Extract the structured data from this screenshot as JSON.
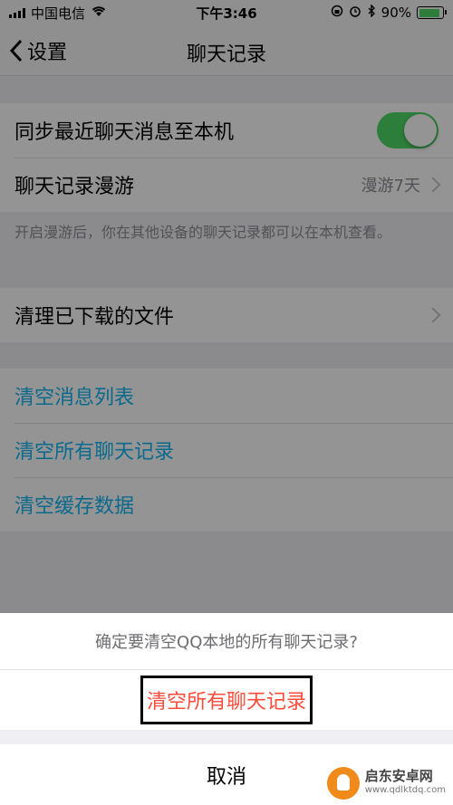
{
  "status_bar": {
    "carrier": "中国电信",
    "time": "下午3:46",
    "battery": "90%",
    "battery_level": 0.9
  },
  "nav": {
    "back_label": "设置",
    "title": "聊天记录"
  },
  "settings": {
    "sync_label": "同步最近聊天消息至本机",
    "sync_on": true,
    "roam_label": "聊天记录漫游",
    "roam_value": "漫游7天",
    "roam_note": "开启漫游后，你在其他设备的聊天记录都可以在本机查看。",
    "clean_downloads_label": "清理已下载的文件",
    "clear_message_list": "清空消息列表",
    "clear_all_history": "清空所有聊天记录",
    "clear_cache": "清空缓存数据"
  },
  "action_sheet": {
    "title": "确定要清空QQ本地的所有聊天记录?",
    "confirm_label": "清空所有聊天记录",
    "cancel_label": "取消"
  },
  "watermark": {
    "name": "启东安卓网",
    "url": "www.qdlktdq.com"
  },
  "colors": {
    "accent": "#12b7f5",
    "destructive": "#fe4b3a",
    "toggle_on": "#4cd964"
  }
}
